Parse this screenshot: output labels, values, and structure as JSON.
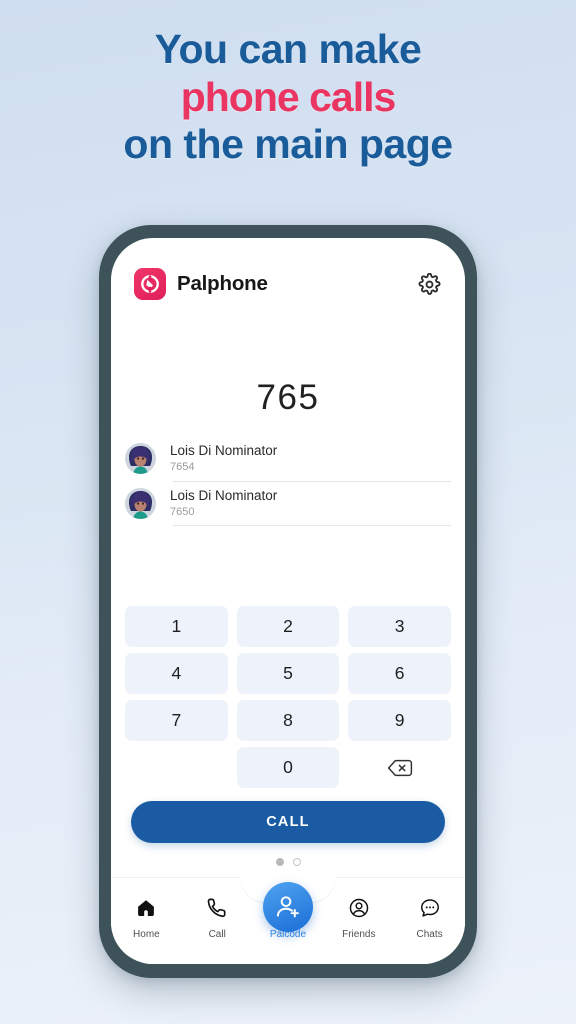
{
  "headline": {
    "line1": "You can make",
    "line2": "phone calls",
    "line3": "on the main page",
    "color_primary": "#1a5b99",
    "color_accent": "#ea3563"
  },
  "app": {
    "brand_name": "Palphone",
    "logo_icon": "palphone-logo-icon",
    "settings_icon": "gear-icon",
    "dialed_number": "765",
    "contacts": [
      {
        "name": "Lois Di Nominator",
        "number": "7654",
        "avatar_icon": "avatar-photo"
      },
      {
        "name": "Lois Di Nominator",
        "number": "7650",
        "avatar_icon": "avatar-photo"
      }
    ],
    "keypad": {
      "keys": [
        "1",
        "2",
        "3",
        "4",
        "5",
        "6",
        "7",
        "8",
        "9"
      ],
      "zero": "0",
      "backspace_icon": "backspace-icon"
    },
    "call_button": "CALL",
    "pager": {
      "total": 2,
      "active_index": 0
    },
    "bottom_nav": [
      {
        "label": "Home",
        "icon": "home-icon",
        "active": false
      },
      {
        "label": "Call",
        "icon": "phone-icon",
        "active": false
      },
      {
        "label": "Palcode",
        "icon": "person-add-icon",
        "active": true
      },
      {
        "label": "Friends",
        "icon": "person-circle-icon",
        "active": false
      },
      {
        "label": "Chats",
        "icon": "chat-bubble-icon",
        "active": false
      }
    ]
  },
  "theme": {
    "frame_color": "#3d5359",
    "key_bg": "#eef2fa",
    "call_blue": "#1a5ba3",
    "accent_blue": "#2f86e4",
    "brand_pink": "#e01f58"
  }
}
